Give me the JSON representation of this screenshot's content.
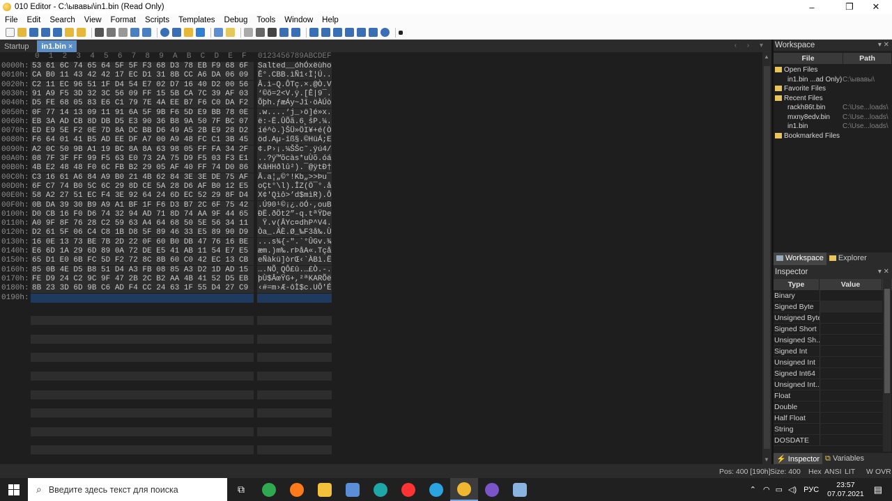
{
  "window": {
    "title": "010 Editor - C:\\ывавы\\in1.bin (Read Only)",
    "minimize": "–",
    "maximize": "❐",
    "close": "✕"
  },
  "menu": [
    "File",
    "Edit",
    "Search",
    "View",
    "Format",
    "Scripts",
    "Templates",
    "Debug",
    "Tools",
    "Window",
    "Help"
  ],
  "tabs": {
    "startup": "Startup",
    "active": "in1.bin",
    "close": "×",
    "nav": "‹ › ▾"
  },
  "editor": {
    "col_header_hex": "0  1  2  3  4  5  6  7  8  9  A  B  C  D  E  F",
    "col_header_ascii": "0123456789ABCDEF",
    "rows": [
      {
        "off": "0000h:",
        "hex": "53 61 6C 74 65 64 5F 5F F3 68 D3 78 EB F9 68 6F",
        "asc": "Salted__óhÓxëùho"
      },
      {
        "off": "0010h:",
        "hex": "CA B0 11 43 42 42 17 EC D1 31 8B CC A6 DA 06 09",
        "asc": "Ê°.CBB.ìÑ1‹Ì¦Ú.."
      },
      {
        "off": "0020h:",
        "hex": "C2 11 EC 96 51 1F D4 54 E7 02 D7 16 40 D2 00 56",
        "asc": "Â.ì–Q.ÔTç.×.@Ò.V"
      },
      {
        "off": "0030h:",
        "hex": "91 A9 F5 3D 32 3C 56 09 FF 15 5B CA 7C 39 AF 03",
        "asc": "‘©õ=2<V.ÿ.[Ê|9¯."
      },
      {
        "off": "0040h:",
        "hex": "D5 FE 68 05 83 E6 C1 79 7E 4A EE B7 F6 C0 DA F2",
        "asc": "Õþh.ƒæÁy~Jî·öÀÚò"
      },
      {
        "off": "0050h:",
        "hex": "0F 77 14 13 09 11 91 6A 5F 9B F6 5D E9 BB 78 0E",
        "asc": ".w....‘j_›ö]é»x."
      },
      {
        "off": "0060h:",
        "hex": "EB 3A AD CB 8D DB D5 E3 90 36 B8 9A 50 7F BC 07",
        "asc": "ë:-Ë.ÛÕã.6¸šP.¼."
      },
      {
        "off": "0070h:",
        "hex": "ED E9 5E F2 0E 7D 8A DC BB D6 49 A5 2B E9 28 D2",
        "asc": "íé^ò.}ŠÜ»ÖI¥+é(Ò"
      },
      {
        "off": "0080h:",
        "hex": "F6 64 01 41 B5 AD EE DF A7 00 A9 48 FC C1 3B 45",
        "asc": "öd.Aµ-îß§.©HüÁ;E"
      },
      {
        "off": "0090h:",
        "hex": "A2 0C 50 9B A1 19 BC 8A 8A 63 98 05 FF FA 34 2F",
        "asc": "¢.P›¡.¼ŠŠc˜.ÿú4/"
      },
      {
        "off": "00A0h:",
        "hex": "08 7F 3F FF 99 F5 63 E0 73 2A 75 D9 F5 03 F3 E1",
        "asc": "..?ÿ™õcàs*uÙõ.óá"
      },
      {
        "off": "00B0h:",
        "hex": "4B E2 48 48 F0 6C FB B2 29 05 AF 40 FF 74 D0 86",
        "asc": "KâHHðlû²).¯@ÿtÐ†"
      },
      {
        "off": "00C0h:",
        "hex": "C3 16 61 A6 84 A9 B0 21 4B 62 84 3E 3E DE 75 AF",
        "asc": "Ã.a¦„©°!Kb„>>Þu¯"
      },
      {
        "off": "00D0h:",
        "hex": "6F C7 74 B0 5C 6C 29 8D CE 5A 28 D6 AF B0 12 E5",
        "asc": "oÇt°\\l).ÎZ(Ö¯°.å"
      },
      {
        "off": "00E0h:",
        "hex": "58 A2 27 51 EC F4 3E 92 64 24 6D EC 52 29 8F D4",
        "asc": "X¢'Qìô>’d$mìR).Ô"
      },
      {
        "off": "00F0h:",
        "hex": "0B DA 39 30 B9 A9 A1 BF 1F F6 D3 B7 2C 6F 75 42",
        "asc": ".Ú90¹©¡¿.öÓ·,ouB"
      },
      {
        "off": "0100h:",
        "hex": "D0 CB 16 F0 D6 74 32 94 AD 71 8D 74 AA 9F 44 65",
        "asc": "ÐË.ðÖt2”-q.tªŸDe"
      },
      {
        "off": "0110h:",
        "hex": "A0 9F 8F 76 28 C2 59 63 A4 64 68 50 5E 56 34 11",
        "asc": " Ÿ.v(ÂYc¤dhP^V4."
      },
      {
        "off": "0120h:",
        "hex": "D2 61 5F 06 C4 C8 1B D8 5F 89 46 33 E5 89 90 D9",
        "asc": "Òa_.ÄÈ.Ø_‰F3å‰.Ù"
      },
      {
        "off": "0130h:",
        "hex": "16 0E 13 73 BE 7B 2D 22 0F 60 B0 DB 47 76 16 BE",
        "asc": "...s¾{-\".`°ÛGv.¾"
      },
      {
        "off": "0140h:",
        "hex": "E6 6D 1A 29 6D 89 0A 72 DE E5 41 AB 11 54 E7 E5",
        "asc": "æm.)m‰.rÞåA«.Tçå"
      },
      {
        "off": "0150h:",
        "hex": "65 D1 E0 6B FC 5D F2 72 8C 8B 60 C0 42 EC 13 CB",
        "asc": "eÑàkü]òrŒ‹`ÀBì.Ë"
      },
      {
        "off": "0160h:",
        "hex": "85 0B 4E D5 B8 51 D4 A3 FB 08 85 A3 D2 1D AD 15",
        "asc": "….NÕ¸QÔ£û.…£Ò.-."
      },
      {
        "off": "0170h:",
        "hex": "FE D9 24 C2 9C 9F 47 2B 2C B2 AA 4B 41 52 D5 EB",
        "asc": "þÙ$ÂœŸG+,²ªKARÕë"
      },
      {
        "off": "0180h:",
        "hex": "8B 23 3D 6D 9B C6 AD F4 CC 24 63 1F 55 D4 27 C9",
        "asc": "‹#=m›Æ-ôÌ$c.UÔ'É"
      },
      {
        "off": "0190h:",
        "hex": "",
        "asc": ""
      }
    ]
  },
  "workspace": {
    "title": "Workspace",
    "pin": "▾ ✕",
    "col_file": "File",
    "col_path": "Path",
    "tree": [
      {
        "label": "Open Files",
        "path": "",
        "folder": true,
        "indent": 0
      },
      {
        "label": "in1.bin ...ad Only)",
        "path": "C:\\ывавы\\",
        "folder": false,
        "indent": 1
      },
      {
        "label": "Favorite Files",
        "path": "",
        "folder": true,
        "indent": 0
      },
      {
        "label": "Recent Files",
        "path": "",
        "folder": true,
        "indent": 0
      },
      {
        "label": "rackh86t.bin",
        "path": "C:\\Use...loads\\",
        "folder": false,
        "indent": 1
      },
      {
        "label": "mxny8edv.bin",
        "path": "C:\\Use...loads\\",
        "folder": false,
        "indent": 1
      },
      {
        "label": "in1.bin",
        "path": "C:\\Use...loads\\",
        "folder": false,
        "indent": 1
      },
      {
        "label": "Bookmarked Files",
        "path": "",
        "folder": true,
        "indent": 0
      }
    ]
  },
  "panel_tabs": {
    "workspace": "Workspace",
    "explorer": "Explorer"
  },
  "inspector": {
    "title": "Inspector",
    "pin": "▾ ✕",
    "col_type": "Type",
    "col_value": "Value",
    "types": [
      "Binary",
      "Signed Byte",
      "Unsigned Byte",
      "Signed Short",
      "Unsigned Sh...",
      "Signed Int",
      "Unsigned Int",
      "Signed Int64",
      "Unsigned Int...",
      "Float",
      "Double",
      "Half Float",
      "String",
      "DOSDATE"
    ]
  },
  "bottom_tabs": {
    "inspector": "Inspector",
    "variables": "Variables"
  },
  "status": {
    "pos": "Pos: 400 [190h]",
    "size": "Size: 400",
    "hex": "Hex",
    "ansi": "ANSI",
    "lit": "LIT",
    "w": "W",
    "ovr": "OVR"
  },
  "taskbar": {
    "search_placeholder": "Введите здесь текст для поиска",
    "lang": "РУС",
    "time": "23:57",
    "date": "07.07.2021"
  },
  "colors": {
    "accent_tab": "#5a8ec5",
    "selection": "#1f3a5f",
    "editor_bg": "#1e1e1e"
  }
}
